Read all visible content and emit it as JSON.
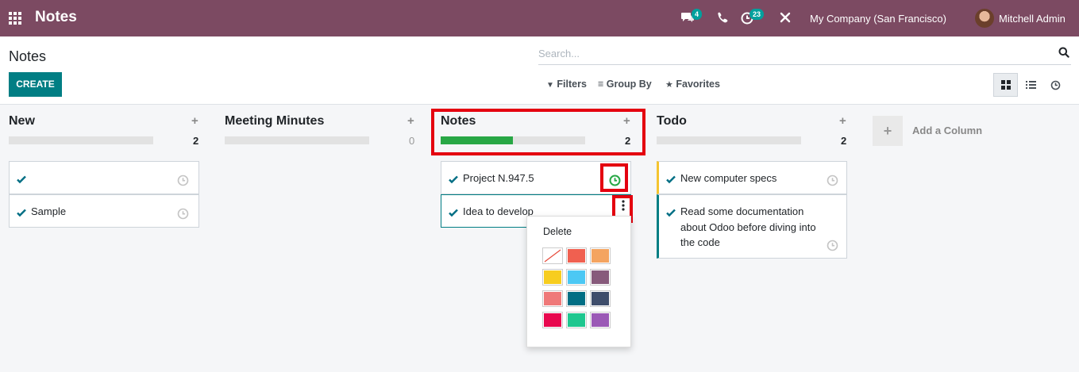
{
  "navbar": {
    "brand": "Notes",
    "messages_count": "4",
    "activities_count": "23",
    "company": "My Company (San Francisco)",
    "user": "Mitchell Admin"
  },
  "control_panel": {
    "title": "Notes",
    "create_label": "CREATE",
    "search_placeholder": "Search...",
    "filters_label": "Filters",
    "group_by_label": "Group By",
    "favorites_label": "Favorites"
  },
  "columns": [
    {
      "title": "New",
      "count": "2",
      "progress": 0,
      "cards": [
        {
          "text": ""
        },
        {
          "text": "Sample"
        }
      ]
    },
    {
      "title": "Meeting Minutes",
      "count": "0",
      "progress": 0,
      "cards": []
    },
    {
      "title": "Notes",
      "count": "2",
      "progress": 0.5,
      "cards": [
        {
          "text": "Project N.947.5"
        },
        {
          "text": "Idea to develop"
        }
      ]
    },
    {
      "title": "Todo",
      "count": "2",
      "progress": 0,
      "cards": [
        {
          "text": "New computer specs",
          "color": "#f4c430"
        },
        {
          "text": "Read some documentation about Odoo before diving into the code",
          "color": "#017e84"
        }
      ]
    }
  ],
  "add_column_label": "Add a Column",
  "dropdown": {
    "delete_label": "Delete",
    "colors": [
      "none",
      "#f06050",
      "#f4a460",
      "#f7cd1f",
      "#4cc8f4",
      "#875a7b",
      "#ef7979",
      "#016e84",
      "#3f4e6b",
      "#e8084e",
      "#1fc78f",
      "#9b59b6"
    ]
  },
  "colors": {
    "navbar": "#7c4a62",
    "primary": "#017e84",
    "progress": "#28a745",
    "highlight": "#e4000f"
  }
}
